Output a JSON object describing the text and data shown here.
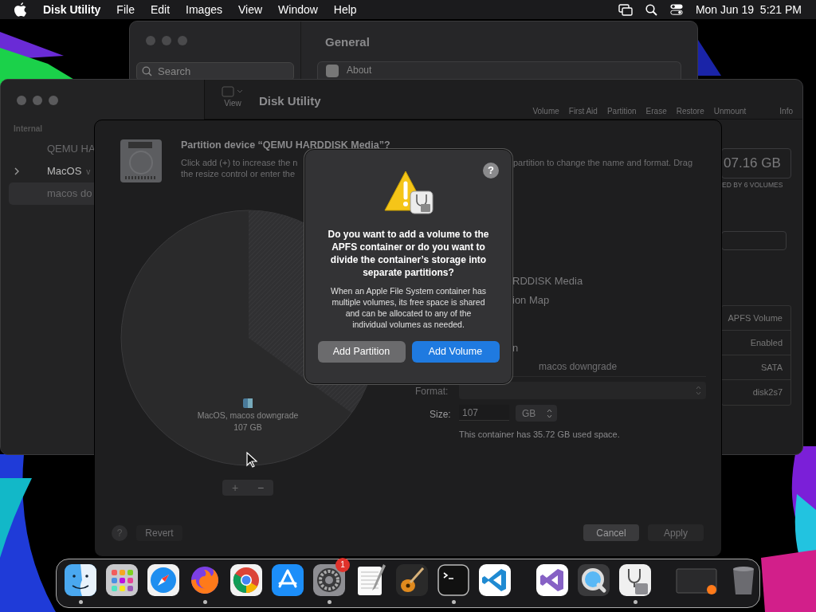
{
  "menu_bar": {
    "app": "Disk Utility",
    "menus": [
      "File",
      "Edit",
      "Images",
      "View",
      "Window",
      "Help"
    ],
    "clock": "Mon Jun 19  5:21 PM"
  },
  "settings_window": {
    "title": "General",
    "search": {
      "placeholder": "Search"
    },
    "row": "About"
  },
  "disk_utility": {
    "title": "Disk Utility",
    "view_label": "View",
    "toolbar": [
      "Volume",
      "First Aid",
      "Partition",
      "Erase",
      "Restore",
      "Unmount",
      "Info"
    ],
    "sidebar": {
      "section": "Internal",
      "items": [
        {
          "label": "QEMU HA",
          "selected": false
        },
        {
          "label": "MacOS",
          "expanded": false,
          "selected": false,
          "suffix": "v"
        },
        {
          "label": "macos do",
          "selected": true
        }
      ]
    },
    "capacity": "07.16 GB",
    "capacity_note": "ED BY 6 VOLUMES",
    "info": [
      "APFS Volume",
      "Enabled",
      "SATA",
      "disk2s7"
    ]
  },
  "partition_sheet": {
    "title": "Partition device “QEMU HARDDISK Media”?",
    "description_left": [
      "Click add (+) to increase the n",
      "the resize control or enter the"
    ],
    "description_right": "partition to change the name and format. Drag",
    "pie_label": "MacOS, macos downgrade",
    "pie_size": "107 GB",
    "details": [
      "RDDISK Media",
      "ion Map",
      "n"
    ],
    "name_value": "macos downgrade",
    "format_label": "Format:",
    "size_label": "Size:",
    "size_value": "107",
    "size_unit": "GB",
    "note": "This container has 35.72 GB used space.",
    "add": "+",
    "remove": "−",
    "help": "?",
    "revert": "Revert",
    "cancel": "Cancel",
    "apply": "Apply"
  },
  "alert": {
    "help": "?",
    "title": "Do you want to add a volume to the APFS container or do you want to divide the container’s storage into separate partitions?",
    "body": "When an Apple File System container has multiple volumes, its free space is shared and can be allocated to any of the individual volumes as needed.",
    "buttons": [
      {
        "label": "Add Partition",
        "default": false
      },
      {
        "label": "Add Volume",
        "default": true
      }
    ]
  },
  "dock": {
    "apps": [
      {
        "kind": "finder",
        "running": true
      },
      {
        "kind": "launchpad",
        "running": false
      },
      {
        "kind": "safari",
        "running": false
      },
      {
        "kind": "firefox",
        "running": true
      },
      {
        "kind": "chrome",
        "running": false
      },
      {
        "kind": "appstore",
        "running": false
      },
      {
        "kind": "settings",
        "running": true,
        "badge": "1"
      },
      {
        "kind": "textedit",
        "running": false
      },
      {
        "kind": "garageband",
        "running": false
      },
      {
        "kind": "terminal",
        "running": true
      },
      {
        "kind": "vscode",
        "running": false
      },
      {
        "kind": "divider"
      },
      {
        "kind": "visualstudio",
        "running": false
      },
      {
        "kind": "quicktime",
        "running": false
      },
      {
        "kind": "diskutility",
        "running": true
      },
      {
        "kind": "divider"
      },
      {
        "kind": "window",
        "running": false
      },
      {
        "kind": "trash",
        "running": false
      }
    ]
  }
}
